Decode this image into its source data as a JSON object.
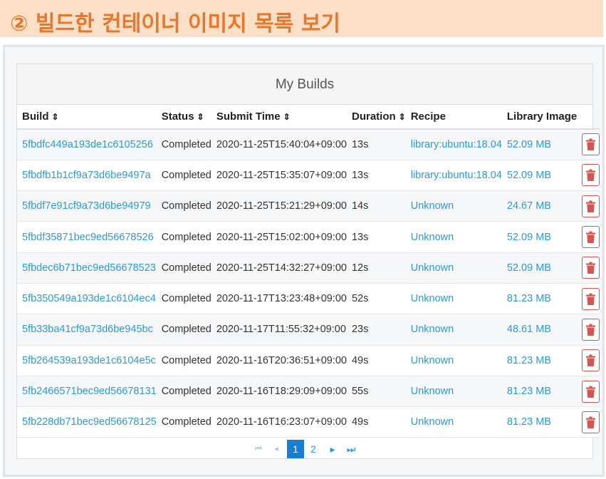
{
  "header": {
    "title": "② 빌드한 컨테이너 이미지 목록 보기"
  },
  "panel": {
    "title": "My Builds"
  },
  "columns": {
    "build": "Build",
    "status": "Status",
    "submit_time": "Submit Time",
    "duration": "Duration",
    "recipe": "Recipe",
    "library_image": "Library Image"
  },
  "sort_icon": "⇕",
  "rows": [
    {
      "build": "5fbdfc449a193de1c6105256",
      "status": "Completed",
      "submit_time": "2020-11-25T15:40:04+09:00",
      "duration": "13s",
      "recipe": "library:ubuntu:18.04",
      "library_image": "52.09 MB"
    },
    {
      "build": "5fbdfb1b1cf9a73d6be9497a",
      "status": "Completed",
      "submit_time": "2020-11-25T15:35:07+09:00",
      "duration": "13s",
      "recipe": "library:ubuntu:18.04",
      "library_image": "52.09 MB"
    },
    {
      "build": "5fbdf7e91cf9a73d6be94979",
      "status": "Completed",
      "submit_time": "2020-11-25T15:21:29+09:00",
      "duration": "14s",
      "recipe": "Unknown",
      "library_image": "24.67 MB"
    },
    {
      "build": "5fbdf35871bec9ed56678526",
      "status": "Completed",
      "submit_time": "2020-11-25T15:02:00+09:00",
      "duration": "13s",
      "recipe": "Unknown",
      "library_image": "52.09 MB"
    },
    {
      "build": "5fbdec6b71bec9ed56678523",
      "status": "Completed",
      "submit_time": "2020-11-25T14:32:27+09:00",
      "duration": "12s",
      "recipe": "Unknown",
      "library_image": "52.09 MB"
    },
    {
      "build": "5fb350549a193de1c6104ec4",
      "status": "Completed",
      "submit_time": "2020-11-17T13:23:48+09:00",
      "duration": "52s",
      "recipe": "Unknown",
      "library_image": "81.23 MB"
    },
    {
      "build": "5fb33ba41cf9a73d6be945bc",
      "status": "Completed",
      "submit_time": "2020-11-17T11:55:32+09:00",
      "duration": "23s",
      "recipe": "Unknown",
      "library_image": "48.61 MB"
    },
    {
      "build": "5fb264539a193de1c6104e5c",
      "status": "Completed",
      "submit_time": "2020-11-16T20:36:51+09:00",
      "duration": "49s",
      "recipe": "Unknown",
      "library_image": "81.23 MB"
    },
    {
      "build": "5fb2466571bec9ed56678131",
      "status": "Completed",
      "submit_time": "2020-11-16T18:29:09+09:00",
      "duration": "55s",
      "recipe": "Unknown",
      "library_image": "81.23 MB"
    },
    {
      "build": "5fb228db71bec9ed56678125",
      "status": "Completed",
      "submit_time": "2020-11-16T16:23:07+09:00",
      "duration": "49s",
      "recipe": "Unknown",
      "library_image": "81.23 MB"
    }
  ],
  "row_action_icon": "trash-icon",
  "pagination": {
    "first": "⏮",
    "prev": "◂",
    "pages": [
      "1",
      "2"
    ],
    "active_page": "1",
    "next": "▸",
    "last": "⏭"
  },
  "colors": {
    "accent": "#e8762b",
    "banner_bg": "#fbdfc6",
    "link": "#2b9ad8",
    "danger": "#d9534f",
    "page_active": "#1a7ed0"
  }
}
